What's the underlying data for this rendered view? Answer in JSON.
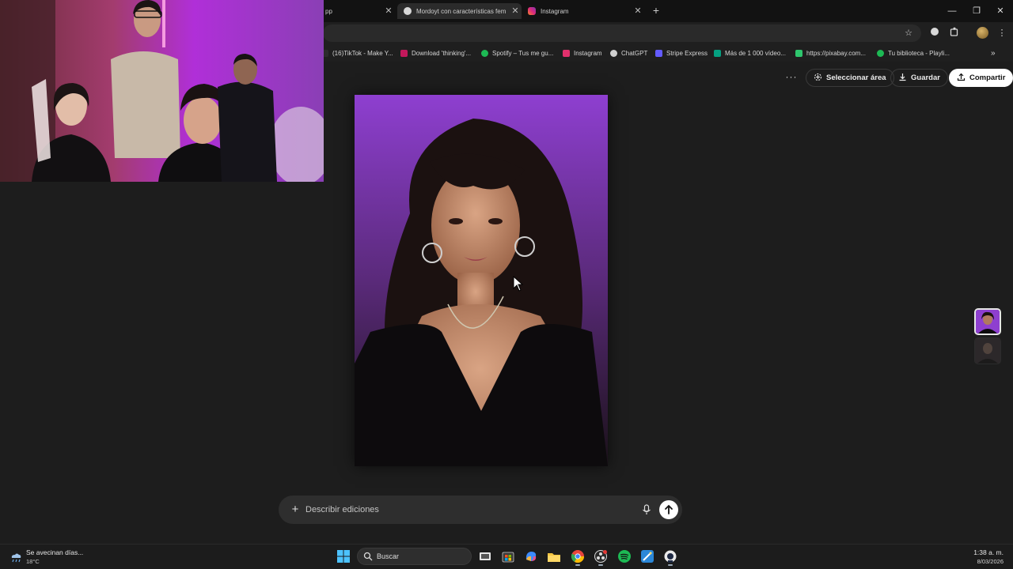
{
  "browser": {
    "tabs": [
      {
        "title": "pp",
        "favicon": "whatsapp-icon"
      },
      {
        "title": "Mordoyt con características fem",
        "favicon": "chatgpt-icon",
        "active": true
      },
      {
        "title": "Instagram",
        "favicon": "instagram-icon"
      }
    ],
    "tab_close_symbol": "✕",
    "new_tab_symbol": "+",
    "window_controls": {
      "minimize": "—",
      "restore": "❐",
      "close": "✕"
    },
    "bookmarks": [
      {
        "label": "(16)TikTok - Make Y...",
        "color": "#2c2c2c"
      },
      {
        "label": "Download 'thinking'...",
        "color": "#c2185b"
      },
      {
        "label": "Spotify – Tus me gu...",
        "color": "#1db954"
      },
      {
        "label": "Instagram",
        "color": "#e1306c"
      },
      {
        "label": "ChatGPT",
        "color": "#cfcfcf"
      },
      {
        "label": "Stripe Express",
        "color": "#635bff"
      },
      {
        "label": "Más de 1 000 vídeo...",
        "color": "#05a081"
      },
      {
        "label": "https://pixabay.com...",
        "color": "#2ec66d"
      },
      {
        "label": "Tu biblioteca - Playli...",
        "color": "#1db954"
      }
    ],
    "bookmarks_overflow": "»"
  },
  "header": {
    "more_label": "···",
    "select_area_label": "Seleccionar área",
    "save_label": "Guardar",
    "share_label": "Compartir"
  },
  "composer": {
    "plus_symbol": "+",
    "placeholder": "Describir ediciones"
  },
  "taskbar": {
    "weather_text": "Se avecinan días...",
    "temperature": "18°C",
    "search_label": "Buscar",
    "time": "1:38 a. m.",
    "date": "8/03/2026"
  },
  "colors": {
    "accent_purple": "#8e3fd0",
    "background": "#1d1d1d",
    "webcam_magenta": "#b02fd8"
  }
}
